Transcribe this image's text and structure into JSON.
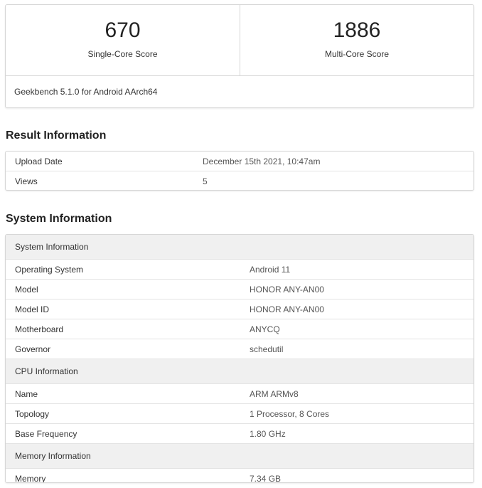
{
  "scores": {
    "single": {
      "value": "670",
      "label": "Single-Core Score"
    },
    "multi": {
      "value": "1886",
      "label": "Multi-Core Score"
    },
    "version": "Geekbench 5.1.0 for Android AArch64"
  },
  "result_info": {
    "title": "Result Information",
    "rows": [
      {
        "key": "Upload Date",
        "value": "December 15th 2021, 10:47am"
      },
      {
        "key": "Views",
        "value": "5"
      }
    ]
  },
  "system_info": {
    "title": "System Information",
    "sections": [
      {
        "heading": "System Information",
        "rows": [
          {
            "key": "Operating System",
            "value": "Android 11"
          },
          {
            "key": "Model",
            "value": "HONOR ANY-AN00"
          },
          {
            "key": "Model ID",
            "value": "HONOR ANY-AN00"
          },
          {
            "key": "Motherboard",
            "value": "ANYCQ"
          },
          {
            "key": "Governor",
            "value": "schedutil"
          }
        ]
      },
      {
        "heading": "CPU Information",
        "rows": [
          {
            "key": "Name",
            "value": "ARM ARMv8"
          },
          {
            "key": "Topology",
            "value": "1 Processor, 8 Cores"
          },
          {
            "key": "Base Frequency",
            "value": "1.80 GHz"
          }
        ]
      },
      {
        "heading": "Memory Information",
        "rows": [
          {
            "key": "Memory",
            "value": "7.34 GB"
          }
        ]
      }
    ]
  }
}
